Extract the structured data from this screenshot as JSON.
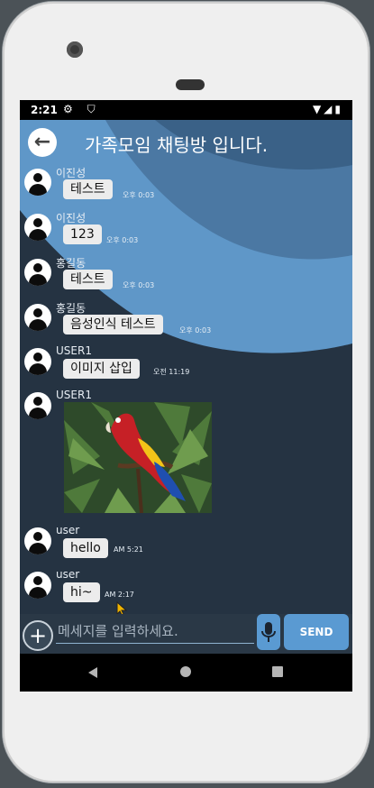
{
  "status": {
    "time": "2:21",
    "icons": "⚙ ⛉",
    "right": "▼◢▮"
  },
  "header": {
    "title": "가족모임 채팅방 입니다."
  },
  "messages": [
    {
      "sender": "이진성",
      "text": "테스트",
      "time": "오후 0:03"
    },
    {
      "sender": "이진성",
      "text": "123",
      "time": "오후 0:03"
    },
    {
      "sender": "홍길동",
      "text": "테스트",
      "time": "오후 0:03"
    },
    {
      "sender": "홍길동",
      "text": "음성인식 테스트",
      "time": "오후 0:03"
    },
    {
      "sender": "USER1",
      "text": "이미지 삽입",
      "time": "오전 11:19"
    },
    {
      "sender": "USER1",
      "image": "parrot-photo"
    },
    {
      "sender": "user",
      "text": "hello",
      "time": "AM 5:21"
    },
    {
      "sender": "user",
      "text": "hi~",
      "time": "AM 2:17"
    }
  ],
  "composer": {
    "placeholder": "메세지를 입력하세요.",
    "send_label": "SEND"
  },
  "colors": {
    "accent": "#5a9ad2",
    "background": "#253342"
  },
  "icons": [
    "back-arrow-icon",
    "plus-icon",
    "mic-icon",
    "avatar-icon",
    "nav-back-icon",
    "nav-home-icon",
    "nav-recents-icon"
  ]
}
